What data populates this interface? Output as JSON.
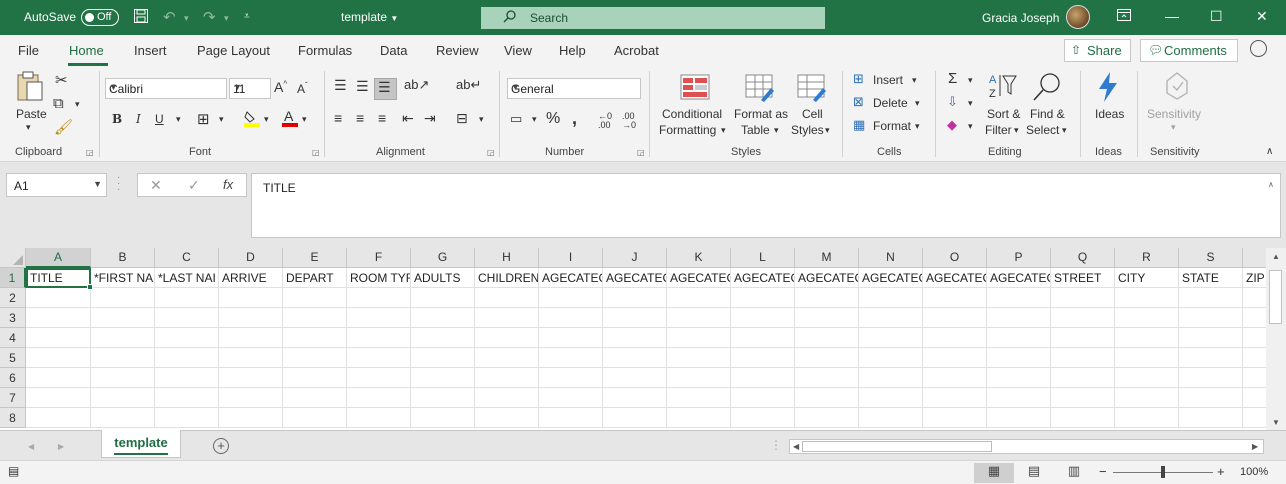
{
  "titlebar": {
    "autosave_label": "AutoSave",
    "autosave_state": "Off",
    "doc_title": "template",
    "search_placeholder": "Search",
    "user_name": "Gracia Joseph"
  },
  "ribbon_tabs": [
    "File",
    "Home",
    "Insert",
    "Page Layout",
    "Formulas",
    "Data",
    "Review",
    "View",
    "Help",
    "Acrobat"
  ],
  "active_tab": "Home",
  "share_label": "Share",
  "comments_label": "Comments",
  "clipboard": {
    "paste": "Paste",
    "label": "Clipboard"
  },
  "font": {
    "name": "Calibri",
    "size": "11",
    "bold": "B",
    "italic": "I",
    "underline": "U",
    "label": "Font"
  },
  "alignment": {
    "label": "Alignment"
  },
  "number": {
    "format": "General",
    "label": "Number"
  },
  "styles": {
    "conditional_1": "Conditional",
    "conditional_2": "Formatting",
    "format_as_1": "Format as",
    "format_as_2": "Table",
    "cell_1": "Cell",
    "cell_2": "Styles",
    "label": "Styles"
  },
  "cells": {
    "insert": "Insert",
    "delete": "Delete",
    "format": "Format",
    "label": "Cells"
  },
  "editing": {
    "sort_1": "Sort &",
    "sort_2": "Filter",
    "find_1": "Find &",
    "find_2": "Select",
    "label": "Editing"
  },
  "ideas": {
    "button": "Ideas",
    "label": "Ideas"
  },
  "sensitivity": {
    "button": "Sensitivity",
    "label": "Sensitivity"
  },
  "formula_bar": {
    "name_box": "A1",
    "fx": "fx",
    "content": "TITLE"
  },
  "columns": [
    "A",
    "B",
    "C",
    "D",
    "E",
    "F",
    "G",
    "H",
    "I",
    "J",
    "K",
    "L",
    "M",
    "N",
    "O",
    "P",
    "Q",
    "R",
    "S"
  ],
  "rows": [
    "1",
    "2",
    "3",
    "4",
    "5",
    "6",
    "7",
    "8"
  ],
  "row1": [
    "TITLE",
    "*FIRST NA",
    "*LAST NAI",
    "ARRIVE",
    "DEPART",
    "ROOM TYF",
    "ADULTS",
    "CHILDREN",
    "AGECATEC",
    "AGECATEC",
    "AGECATEC",
    "AGECATEC",
    "AGECATEC",
    "AGECATEC",
    "AGECATEC",
    "AGECATEC",
    "STREET",
    "CITY",
    "STATE",
    "ZIP"
  ],
  "sheet_tab": "template",
  "zoom": "100%"
}
